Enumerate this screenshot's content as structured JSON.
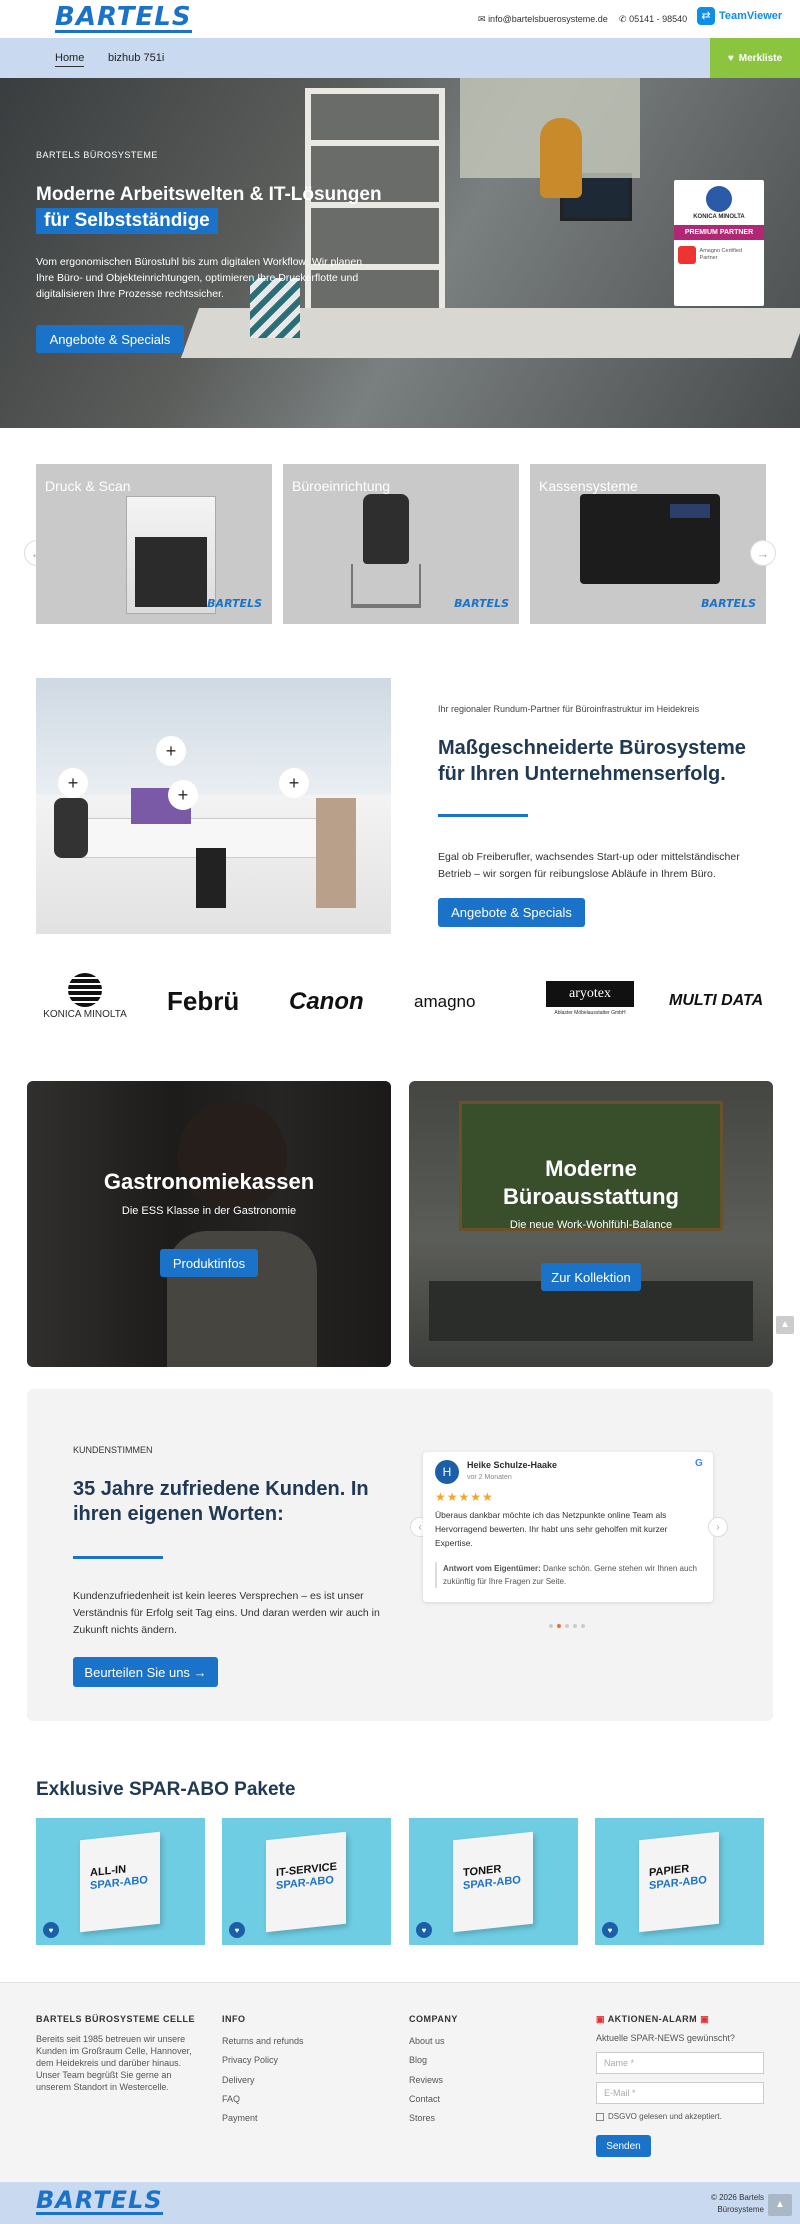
{
  "header": {
    "logo": "BARTELS",
    "email": "info@bartelsbuerosysteme.de",
    "phone": "05141 - 98540",
    "teamviewer": "TeamViewer",
    "nav": [
      "Home",
      "bizhub 751i"
    ],
    "merkliste": "Merkliste"
  },
  "hero": {
    "eyebrow": "BARTELS BÜROSYSTEME",
    "title1": "Moderne Arbeitswelten & IT-Lösungen",
    "title2": "für Selbstständige",
    "text": "Vom ergonomischen Bürostuhl bis zum digitalen Workflow: Wir planen Ihre Büro- und Objekteinrichtungen, optimieren Ihre Druckerflotte und digitalisieren Ihre Prozesse rechtssicher.",
    "button": "Angebote & Specials",
    "badge_brand": "KONICA MINOLTA",
    "badge_premium": "PREMIUM PARTNER",
    "badge_amagno": "Amagno Certified Partner"
  },
  "categories": [
    {
      "label": "Druck & Scan",
      "brand": "BARTELS"
    },
    {
      "label": "Büroeinrichtung",
      "brand": "BARTELS"
    },
    {
      "label": "Kassensysteme",
      "brand": "BARTELS"
    }
  ],
  "intro": {
    "eyebrow": "Ihr regionaler Rundum-Partner für Büroinfrastruktur im Heidekreis",
    "title": "Maßgeschneiderte Bürosysteme für Ihren Unternehmenserfolg.",
    "text": "Egal ob Freiberufler, wachsendes Start-up oder mittelständischer Betrieb – wir sorgen für reibungslose Abläufe in Ihrem Büro.",
    "button": "Angebote & Specials"
  },
  "partners": [
    "KONICA MINOLTA",
    "Febrü",
    "Canon",
    "amagno",
    "aryotex",
    "Ablaster Möbelausstatter GmbH",
    "MULTI DATA"
  ],
  "promos": [
    {
      "title": "Gastronomiekassen",
      "subtitle": "Die ESS Klasse in der Gastronomie",
      "button": "Produktinfos"
    },
    {
      "title": "Moderne Büroausstattung",
      "subtitle": "Die neue Work-Wohlfühl-Balance",
      "button": "Zur Kollektion"
    }
  ],
  "testimonials": {
    "eyebrow": "KUNDENSTIMMEN",
    "title": "35 Jahre zufriedene Kunden. In ihren eigenen Worten:",
    "text": "Kundenzufriedenheit ist kein leeres Versprechen – es ist unser Verständnis für Erfolg seit Tag eins. Und daran werden wir auch in Zukunft nichts ändern.",
    "button": "Beurteilen Sie uns",
    "review": {
      "initial": "H",
      "name": "Heike Schulze-Haake",
      "date": "vor 2 Monaten",
      "stars": "★★★★★",
      "text": "Überaus dankbar möchte ich das Netzpunkte online Team als Hervorragend bewerten. Ihr habt uns sehr geholfen mit kurzer Expertise.",
      "reply_label": "Antwort vom Eigentümer:",
      "reply": "Danke schön. Gerne stehen wir Ihnen auch zukünftig für Ihre Fragen zur Seite.",
      "google": "G"
    }
  },
  "spar": {
    "title": "Exklusive SPAR-ABO Pakete",
    "items": [
      {
        "line1": "ALL-IN",
        "line2": "SPAR-ABO"
      },
      {
        "line1": "IT-SERVICE",
        "line2": "SPAR-ABO"
      },
      {
        "line1": "TONER",
        "line2": "SPAR-ABO"
      },
      {
        "line1": "PAPIER",
        "line2": "SPAR-ABO"
      }
    ]
  },
  "footer": {
    "col1_title": "BARTELS BÜROSYSTEME CELLE",
    "col1_text": "Bereits seit 1985 betreuen wir unsere Kunden im Großraum Celle, Hannover, dem Heidekreis und darüber hinaus. Unser Team begrüßt Sie gerne an unserem Standort in Westercelle.",
    "col2_title": "INFO",
    "col2_links": [
      "Returns and refunds",
      "Privacy Policy",
      "Delivery",
      "FAQ",
      "Payment"
    ],
    "col3_title": "COMPANY",
    "col3_links": [
      "About us",
      "Blog",
      "Reviews",
      "Contact",
      "Stores"
    ],
    "col4_title": "AKTIONEN-ALARM",
    "col4_sub": "Aktuelle SPAR-NEWS gewünscht?",
    "name_placeholder": "Name *",
    "email_placeholder": "E-Mail *",
    "consent": "DSGVO gelesen und akzeptiert.",
    "send": "Senden",
    "copyright": "© 2026 Bartels Bürosysteme"
  },
  "colors": {
    "accent": "#1a73c9",
    "merkliste": "#8bc53f",
    "nav": "#c9daf0"
  }
}
